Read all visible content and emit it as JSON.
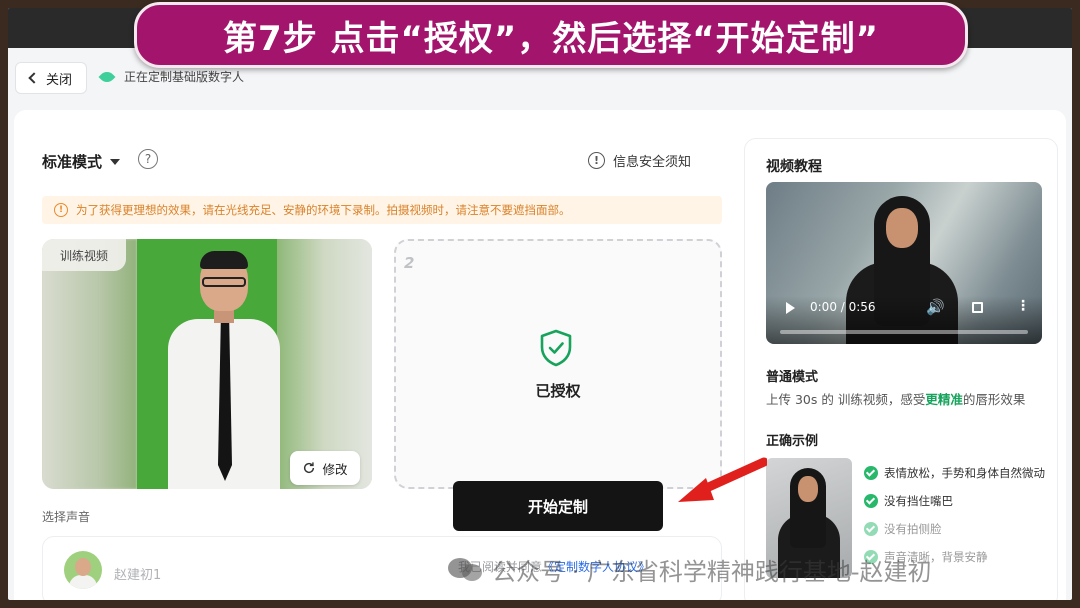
{
  "banner": {
    "text": "第7步 点击“授权”，然后选择“开始定制”"
  },
  "header": {
    "close_label": "关闭",
    "status_text": "正在定制基础版数字人"
  },
  "main": {
    "mode_label": "标准模式",
    "help_glyph": "?",
    "security_label": "信息安全须知",
    "warning_text": "为了获得更理想的效果，请在光线充足、安静的环境下录制。拍摄视频时，请注意不要遮挡面部。",
    "training_tag": "训练视频",
    "edit_label": "修改",
    "step_number": "2",
    "auth_label": "已授权",
    "voice_section_label": "选择声音",
    "voice_name": "赵建初1",
    "start_label": "开始定制",
    "agreement_prefix": "我已阅读并同意",
    "agreement_link": "《定制数字人协议》"
  },
  "sidebar": {
    "tutorial_title": "视频教程",
    "video_time": "0:00 / 0:56",
    "video_progress": 0,
    "normal_mode_title": "普通模式",
    "normal_mode_desc_pre": "上传 30s 的 训练视频，感受",
    "normal_mode_desc_hl": "更精准",
    "normal_mode_desc_post": "的唇形效果",
    "correct_example_title": "正确示例",
    "checks": [
      "表情放松，手势和身体自然微动",
      "没有挡住嘴巴",
      "没有拍侧脸",
      "声音清晰，背景安静"
    ]
  },
  "watermark": {
    "text": "公众号 · 广东省科学精神践行基地-赵建初"
  },
  "icons": {
    "back": "chevron-left-icon",
    "logo": "leaf-logo-icon",
    "help": "question-circle-icon",
    "info": "info-circle-icon",
    "refresh": "refresh-icon",
    "shield": "shield-check-icon",
    "play": "play-icon",
    "volume": "volume-icon",
    "fullscreen": "fullscreen-icon",
    "more": "more-vertical-icon",
    "arrow": "red-arrow-icon"
  },
  "colors": {
    "banner_bg": "#a3146c",
    "accent_green": "#17a35c",
    "warning_text": "#d9822b",
    "link_blue": "#2b6de8",
    "arrow_red": "#e0201c"
  }
}
